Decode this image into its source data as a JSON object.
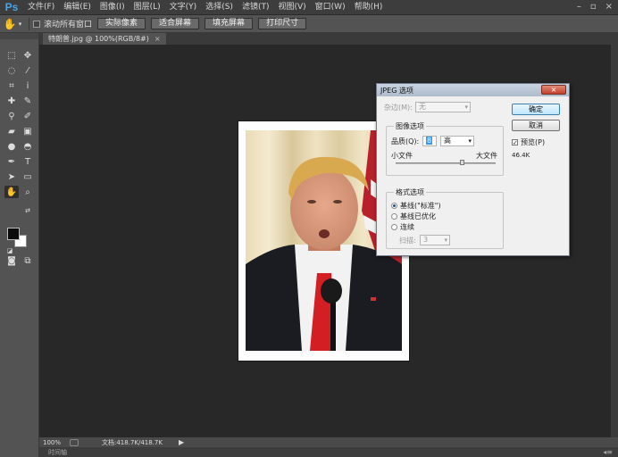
{
  "app": {
    "logo": "Ps"
  },
  "menu": [
    "文件(F)",
    "编辑(E)",
    "图像(I)",
    "图层(L)",
    "文字(Y)",
    "选择(S)",
    "滤镜(T)",
    "视图(V)",
    "窗口(W)",
    "帮助(H)"
  ],
  "options_bar": {
    "checkbox_label": "滚动所有窗口",
    "buttons": [
      "实际像素",
      "适合屏幕",
      "填充屏幕",
      "打印尺寸"
    ]
  },
  "document_tab": {
    "title": "特朗普.jpg @ 100%(RGB/8#)",
    "close": "×"
  },
  "status_bar": {
    "zoom": "100%",
    "doc_info": "文档:418.7K/418.7K",
    "bottom_label": "时间轴"
  },
  "jpeg_dialog": {
    "title": "JPEG 选项",
    "matte_label": "杂边(M):",
    "matte_value": "无",
    "quality_group": "图像选项",
    "quality_label": "品质(Q):",
    "quality_value": "8",
    "quality_level": "高",
    "small_file": "小文件",
    "large_file": "大文件",
    "quality_slider_fraction": 0.67,
    "format_group": "格式选项",
    "formats": [
      "基线(\"标准\")",
      "基线已优化",
      "连续"
    ],
    "selected_format": 0,
    "scans_label": "扫描:",
    "scans_value": "3",
    "ok_button": "确定",
    "cancel_button": "取消",
    "preview_label": "预览(P)",
    "preview_checked": true,
    "file_size": "46.4K"
  },
  "colors": {
    "foreground": "#0b0b0b",
    "background": "#ffffff",
    "ps_blue": "#48a5e8",
    "canvas": "#282828"
  }
}
